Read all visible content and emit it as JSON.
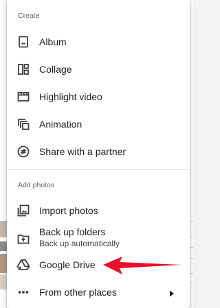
{
  "menu": {
    "create_section": {
      "header": "Create",
      "items": [
        {
          "label": "Album",
          "icon": "album-icon"
        },
        {
          "label": "Collage",
          "icon": "collage-icon"
        },
        {
          "label": "Highlight video",
          "icon": "highlight-video-icon"
        },
        {
          "label": "Animation",
          "icon": "animation-icon"
        },
        {
          "label": "Share with a partner",
          "icon": "share-partner-icon"
        }
      ]
    },
    "add_photos_section": {
      "header": "Add photos",
      "items": [
        {
          "label": "Import photos",
          "icon": "import-photos-icon"
        },
        {
          "label": "Back up folders",
          "sublabel": "Back up automatically",
          "icon": "backup-folder-icon"
        },
        {
          "label": "Google Drive",
          "icon": "google-drive-icon"
        },
        {
          "label": "From other places",
          "icon": "more-horiz-icon"
        }
      ]
    }
  },
  "colors": {
    "icon": "#3c4043",
    "annotation_arrow": "#e8102a",
    "divider": "#dadce0"
  }
}
